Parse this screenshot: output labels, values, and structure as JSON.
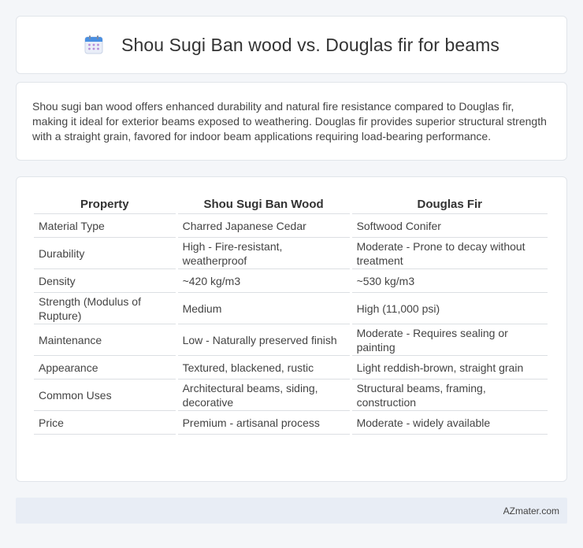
{
  "header": {
    "title": "Shou Sugi Ban wood vs. Douglas fir for beams",
    "icon": "calendar-icon"
  },
  "intro": {
    "text": "Shou sugi ban wood offers enhanced durability and natural fire resistance compared to Douglas fir, making it ideal for exterior beams exposed to weathering. Douglas fir provides superior structural strength with a straight grain, favored for indoor beam applications requiring load-bearing performance."
  },
  "table": {
    "headers": [
      "Property",
      "Shou Sugi Ban Wood",
      "Douglas Fir"
    ],
    "rows": [
      [
        "Material Type",
        "Charred Japanese Cedar",
        "Softwood Conifer"
      ],
      [
        "Durability",
        "High - Fire-resistant, weatherproof",
        "Moderate - Prone to decay without treatment"
      ],
      [
        "Density",
        "~420 kg/m3",
        "~530 kg/m3"
      ],
      [
        "Strength (Modulus of Rupture)",
        "Medium",
        "High (11,000 psi)"
      ],
      [
        "Maintenance",
        "Low - Naturally preserved finish",
        "Moderate - Requires sealing or painting"
      ],
      [
        "Appearance",
        "Textured, blackened, rustic",
        "Light reddish-brown, straight grain"
      ],
      [
        "Common Uses",
        "Architectural beams, siding, decorative",
        "Structural beams, framing, construction"
      ],
      [
        "Price",
        "Premium - artisanal process",
        "Moderate - widely available"
      ]
    ]
  },
  "footer": {
    "text": "AZmater.com"
  },
  "colors": {
    "background": "#f4f6f9",
    "card": "#ffffff",
    "footer": "#e8edf5",
    "icon_blue": "#4a90e2",
    "icon_dots": "#b58ad8"
  }
}
